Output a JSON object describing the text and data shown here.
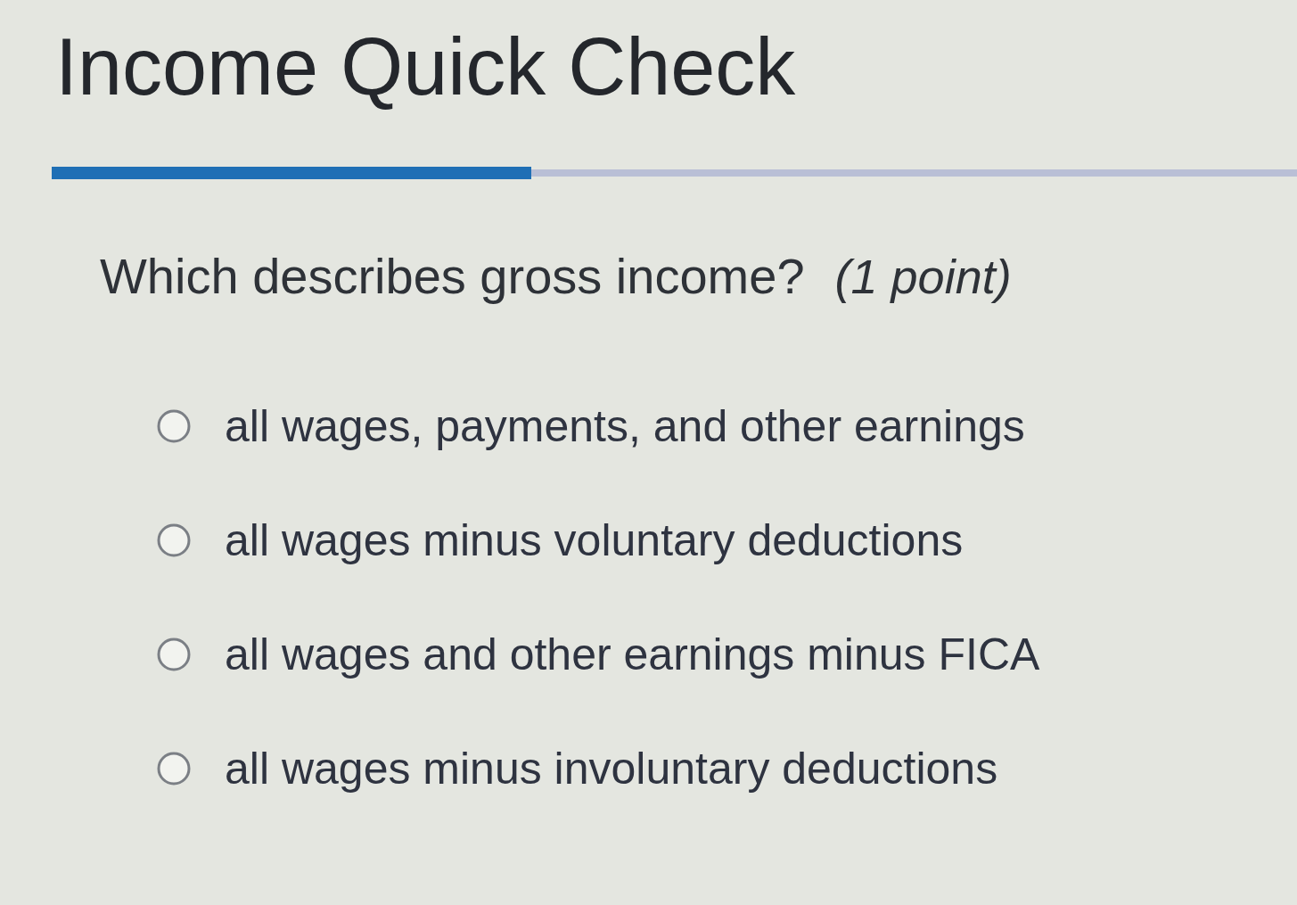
{
  "title": "Income Quick Check",
  "progress": {
    "level": 0.385
  },
  "question": {
    "text": "Which describes gross income?",
    "points": "(1 point)"
  },
  "options": [
    {
      "label": "all wages, payments, and other earnings",
      "selected": false
    },
    {
      "label": "all wages minus voluntary deductions",
      "selected": false
    },
    {
      "label": "all wages and other earnings minus FICA",
      "selected": false
    },
    {
      "label": "all wages minus involuntary deductions",
      "selected": false
    }
  ]
}
